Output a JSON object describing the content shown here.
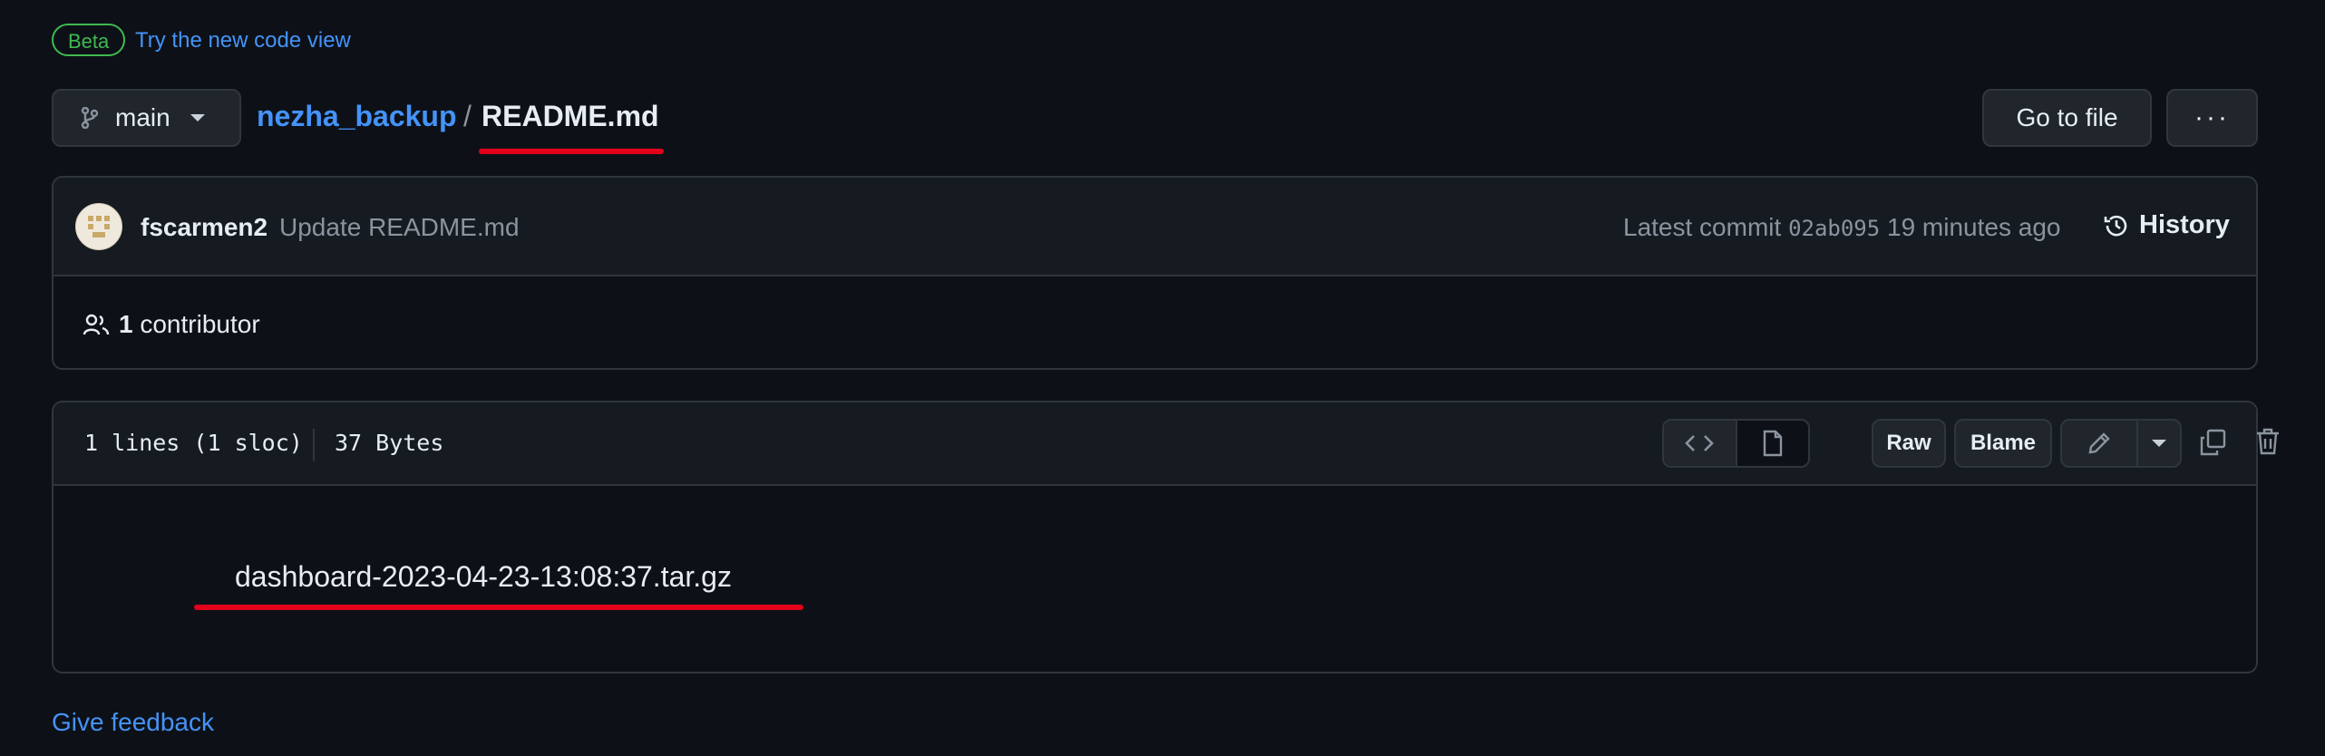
{
  "beta_badge": "Beta",
  "try_code_view_link": "Try the new code view",
  "branch": {
    "name": "main"
  },
  "breadcrumb": {
    "repo": "nezha_backup",
    "separator": "/",
    "file": "README.md"
  },
  "actions": {
    "go_to_file": "Go to file",
    "more": "···"
  },
  "commit": {
    "author": "fscarmen2",
    "message": "Update README.md",
    "latest_label": "Latest commit",
    "sha": "02ab095",
    "time": "19 minutes ago",
    "history_label": "History"
  },
  "contributors": {
    "count": "1",
    "label": "contributor"
  },
  "file_info": {
    "lines": "1 lines (1 sloc)",
    "size": "37 Bytes",
    "raw_label": "Raw",
    "blame_label": "Blame"
  },
  "file_content": "dashboard-2023-04-23-13:08:37.tar.gz",
  "give_feedback": "Give feedback",
  "colors": {
    "link": "#4493f8",
    "beta": "#3fb950",
    "annotation": "#e3001b",
    "background": "#0d1117"
  },
  "icons": [
    "git-branch-icon",
    "history-icon",
    "people-icon",
    "code-icon",
    "file-icon",
    "pencil-icon",
    "copy-icon",
    "trash-icon"
  ]
}
